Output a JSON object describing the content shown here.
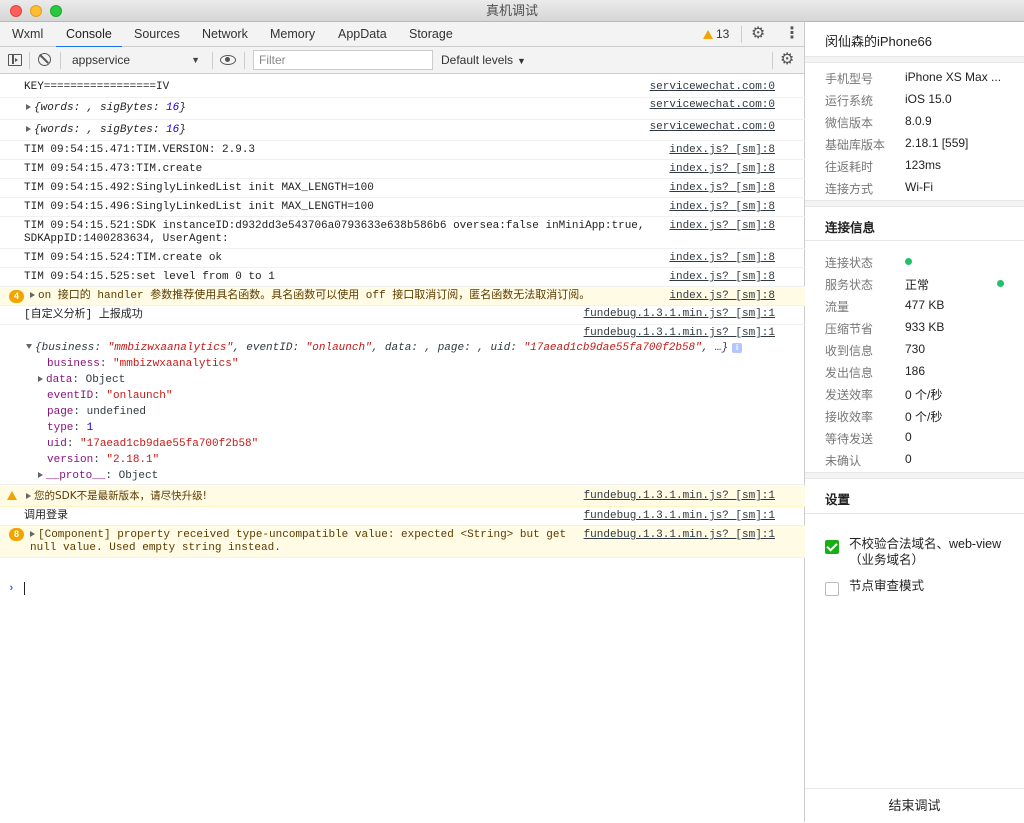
{
  "window": {
    "title": "真机调试"
  },
  "tabs": [
    {
      "label": "Wxml"
    },
    {
      "label": "Console"
    },
    {
      "label": "Sources"
    },
    {
      "label": "Network"
    },
    {
      "label": "Memory"
    },
    {
      "label": "AppData"
    },
    {
      "label": "Storage"
    }
  ],
  "active_tab": "Console",
  "warning_count": "13",
  "toolbar": {
    "context": "appservice",
    "filter_placeholder": "Filter",
    "filter_value": "",
    "levels": "Default levels"
  },
  "console": {
    "rows": [
      {
        "text": "KEY=================IV",
        "source": "servicewechat.com:0"
      },
      {
        "text_a": "{words: , sigBytes: ",
        "text_num": "16",
        "text_b": "}",
        "source": "servicewechat.com:0"
      },
      {
        "text_a": "{words: , sigBytes: ",
        "text_num": "16",
        "text_b": "}",
        "source": "servicewechat.com:0"
      },
      {
        "text": "TIM 09:54:15.471:TIM.VERSION: 2.9.3",
        "source": "index.js? [sm]:8"
      },
      {
        "text": "TIM 09:54:15.473:TIM.create",
        "source": "index.js? [sm]:8"
      },
      {
        "text": "TIM 09:54:15.492:SinglyLinkedList init MAX_LENGTH=100",
        "source": "index.js? [sm]:8"
      },
      {
        "text": "TIM 09:54:15.496:SinglyLinkedList init MAX_LENGTH=100",
        "source": "index.js? [sm]:8"
      },
      {
        "text": "TIM 09:54:15.521:SDK instanceID:d932dd3e543706a0793633e638b586b6 oversea:false inMiniApp:true,\nSDKAppID:1400283634, UserAgent:",
        "source": "index.js? [sm]:8"
      },
      {
        "text": "TIM 09:54:15.524:TIM.create ok",
        "source": "index.js? [sm]:8"
      },
      {
        "text": "TIM 09:54:15.525:set level from 0 to 1",
        "source": "index.js? [sm]:8"
      },
      {
        "badge": "4",
        "text": "on 接口的 handler 参数推荐使用具名函数。具名函数可以使用 off 接口取消订阅，匿名函数无法取消订阅。",
        "source": "index.js? [sm]:8"
      },
      {
        "text": "[自定义分析] 上报成功",
        "source": "fundebug.1.3.1.min.js? [sm]:1"
      },
      {
        "text": "",
        "source": "fundebug.1.3.1.min.js? [sm]:1"
      }
    ],
    "object_summary": {
      "business": "\"mmbizwxaanalytics\"",
      "eventID": "\"onlaunch\"",
      "uid": "\"17aead1cb9dae55fa700f2b58\"",
      "tail": ", …}"
    },
    "object_props": [
      {
        "key": "business",
        "value": "\"mmbizwxaanalytics\"",
        "kind": "str"
      },
      {
        "key": "data",
        "value": "Object",
        "kind": "obj",
        "expandable": true
      },
      {
        "key": "eventID",
        "value": "\"onlaunch\"",
        "kind": "str"
      },
      {
        "key": "page",
        "value": "undefined",
        "kind": "plain"
      },
      {
        "key": "type",
        "value": "1",
        "kind": "num"
      },
      {
        "key": "uid",
        "value": "\"17aead1cb9dae55fa700f2b58\"",
        "kind": "str"
      },
      {
        "key": "version",
        "value": "\"2.18.1\"",
        "kind": "str"
      },
      {
        "key": "__proto__",
        "value": "Object",
        "kind": "obj",
        "expandable": true
      }
    ],
    "tail_rows": [
      {
        "warn_icon": true,
        "text": "您的SDK不是最新版本，请尽快升级!",
        "source": "fundebug.1.3.1.min.js? [sm]:1"
      },
      {
        "text": "调用登录",
        "source": "fundebug.1.3.1.min.js? [sm]:1"
      },
      {
        "badge": "8",
        "text": "[Component] property received type-uncompatible value: expected <String> but get\nnull value. Used empty string instead.",
        "source": "fundebug.1.3.1.min.js? [sm]:1"
      }
    ]
  },
  "panel": {
    "device_name": "闵仙森的iPhone66",
    "device_info": [
      {
        "label": "手机型号",
        "value": "iPhone XS Max ..."
      },
      {
        "label": "运行系统",
        "value": "iOS 15.0"
      },
      {
        "label": "微信版本",
        "value": "8.0.9"
      },
      {
        "label": "基础库版本",
        "value": "2.18.1 [559]"
      },
      {
        "label": "往返耗时",
        "value": "123ms"
      },
      {
        "label": "连接方式",
        "value": "Wi-Fi"
      }
    ],
    "connection_title": "连接信息",
    "connection_info": [
      {
        "label": "连接状态",
        "value": ""
      },
      {
        "label": "服务状态",
        "value": "正常"
      },
      {
        "label": "流量",
        "value": "477 KB"
      },
      {
        "label": "压缩节省",
        "value": "933 KB"
      },
      {
        "label": "收到信息",
        "value": "730"
      },
      {
        "label": "发出信息",
        "value": "186"
      },
      {
        "label": "发送效率",
        "value": "0 个/秒"
      },
      {
        "label": "接收效率",
        "value": "0 个/秒"
      },
      {
        "label": "等待发送",
        "value": "0"
      },
      {
        "label": "未确认",
        "value": "0"
      }
    ],
    "status_color": "#1ec26a",
    "settings_title": "设置",
    "settings": [
      {
        "label": "不校验合法域名、web-view（业务域名）",
        "checked": true
      },
      {
        "label": "节点审查模式",
        "checked": false
      }
    ],
    "end_button": "结束调试"
  },
  "colors": {
    "accent": "#1a73e8",
    "warning": "#f0a500",
    "checkbox_on": "#1aad19"
  }
}
